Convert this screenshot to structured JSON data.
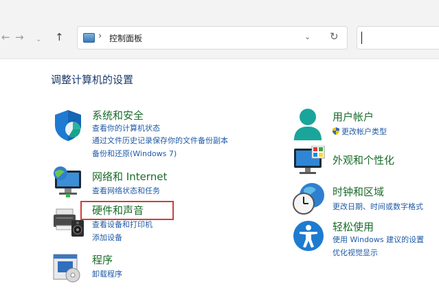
{
  "nav": {
    "back": "←",
    "forward": "→",
    "recent": "⌄",
    "up": "↑"
  },
  "address": {
    "chevron": "›",
    "path": "控制面板",
    "dropdown": "⌄",
    "refresh": "↻"
  },
  "page_title": "调整计算机的设置",
  "categories": [
    {
      "title": "系统和安全",
      "icon": "shield-icon",
      "links": [
        "查看你的计算机状态",
        "通过文件历史记录保存你的文件备份副本",
        "备份和还原(Windows 7)"
      ]
    },
    {
      "title": "网络和 Internet",
      "icon": "network-globe-icon",
      "links": [
        "查看网络状态和任务"
      ]
    },
    {
      "title": "硬件和声音",
      "icon": "printer-speaker-icon",
      "links": [
        "查看设备和打印机",
        "添加设备"
      ]
    },
    {
      "title": "程序",
      "icon": "programs-disc-icon",
      "links": [
        "卸载程序"
      ]
    },
    {
      "title": "用户帐户",
      "icon": "user-icon",
      "links": [
        "更改帐户类型"
      ]
    },
    {
      "title": "外观和个性化",
      "icon": "monitor-palette-icon",
      "links": []
    },
    {
      "title": "时钟和区域",
      "icon": "clock-globe-icon",
      "links": [
        "更改日期、时间或数字格式"
      ]
    },
    {
      "title": "轻松使用",
      "icon": "accessibility-icon",
      "links": [
        "使用 Windows 建议的设置",
        "优化视觉显示"
      ]
    }
  ],
  "colors": {
    "category_title": "#1a6b2a",
    "link": "#1f5aa6",
    "highlight_border": "#c9403a"
  }
}
